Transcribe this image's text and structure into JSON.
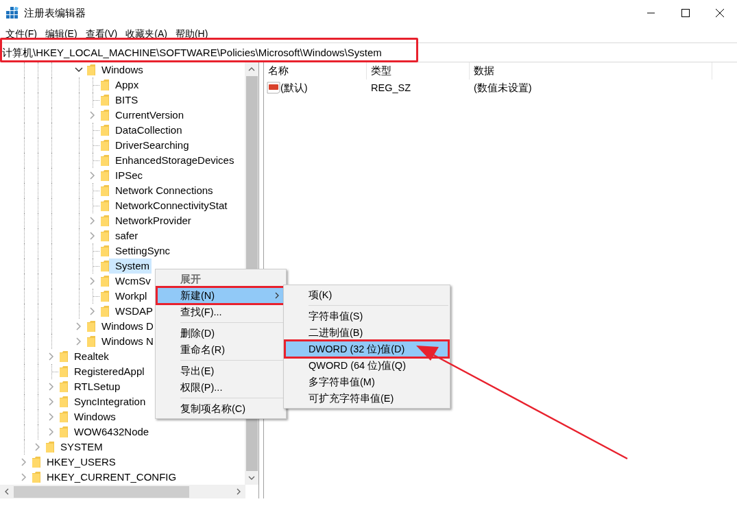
{
  "window": {
    "title": "注册表编辑器"
  },
  "menu_bar": [
    "文件(F)",
    "编辑(E)",
    "查看(V)",
    "收藏夹(A)",
    "帮助(H)"
  ],
  "address_bar": {
    "value": "计算机\\HKEY_LOCAL_MACHINE\\SOFTWARE\\Policies\\Microsoft\\Windows\\System",
    "marked": true
  },
  "tree": {
    "items": [
      {
        "children": [
          {
            "children": [
              {
                "children": [
                  {
                    "children": [
                      {
                        "label": "Windows",
                        "has_children": true,
                        "expanded": true,
                        "selected": false,
                        "children": [
                          {
                            "label": "Appx",
                            "has_children": false,
                            "selected": false
                          },
                          {
                            "label": "BITS",
                            "has_children": false,
                            "selected": false
                          },
                          {
                            "label": "CurrentVersion",
                            "has_children": true,
                            "expanded": false,
                            "selected": false
                          },
                          {
                            "label": "DataCollection",
                            "has_children": false,
                            "selected": false
                          },
                          {
                            "label": "DriverSearching",
                            "has_children": false,
                            "selected": false
                          },
                          {
                            "label": "EnhancedStorageDevices",
                            "has_children": false,
                            "selected": false
                          },
                          {
                            "label": "IPSec",
                            "has_children": true,
                            "expanded": false,
                            "selected": false
                          },
                          {
                            "label": "Network Connections",
                            "has_children": false,
                            "selected": false
                          },
                          {
                            "label": "NetworkConnectivityStat",
                            "has_children": false,
                            "selected": false
                          },
                          {
                            "label": "NetworkProvider",
                            "has_children": true,
                            "expanded": false,
                            "selected": false
                          },
                          {
                            "label": "safer",
                            "has_children": true,
                            "expanded": false,
                            "selected": false
                          },
                          {
                            "label": "SettingSync",
                            "has_children": false,
                            "selected": false
                          },
                          {
                            "label": "System",
                            "has_children": false,
                            "selected": true
                          },
                          {
                            "label": "WcmSv",
                            "has_children": true,
                            "expanded": false,
                            "selected": false
                          },
                          {
                            "label": "Workpl",
                            "has_children": false,
                            "selected": false
                          },
                          {
                            "label": "WSDAP",
                            "has_children": true,
                            "expanded": false,
                            "selected": false
                          }
                        ]
                      },
                      {
                        "label": "Windows D",
                        "has_children": true,
                        "expanded": false,
                        "selected": false
                      },
                      {
                        "label": "Windows N",
                        "has_children": true,
                        "expanded": false,
                        "selected": false
                      }
                    ]
                  }
                ]
              },
              {
                "label": "Realtek",
                "has_children": true,
                "expanded": false,
                "selected": false
              },
              {
                "label": "RegisteredAppl",
                "has_children": false,
                "selected": false
              },
              {
                "label": "RTLSetup",
                "has_children": true,
                "expanded": false,
                "selected": false
              },
              {
                "label": "SyncIntegration",
                "has_children": true,
                "expanded": false,
                "selected": false
              },
              {
                "label": "Windows",
                "has_children": true,
                "expanded": false,
                "selected": false
              },
              {
                "label": "WOW6432Node",
                "has_children": true,
                "expanded": false,
                "selected": false
              }
            ]
          },
          {
            "label": "SYSTEM",
            "has_children": true,
            "expanded": false,
            "selected": false
          }
        ]
      },
      {
        "label": "HKEY_USERS",
        "has_children": true,
        "expanded": false,
        "selected": false
      },
      {
        "label": "HKEY_CURRENT_CONFIG",
        "has_children": true,
        "expanded": false,
        "selected": false
      }
    ]
  },
  "values_list": {
    "columns": [
      "名称",
      "类型",
      "数据"
    ],
    "rows": [
      {
        "name": "(默认)",
        "type": "REG_SZ",
        "data": "(数值未设置)"
      }
    ]
  },
  "context_menu": {
    "items": [
      {
        "kind": "item",
        "label": "展开",
        "default": true,
        "disabled": true,
        "selected": false,
        "submenu": false,
        "marked": false
      },
      {
        "kind": "item",
        "label": "新建(N)",
        "default": false,
        "disabled": false,
        "selected": true,
        "submenu": true,
        "marked": true
      },
      {
        "kind": "item",
        "label": "查找(F)...",
        "default": false,
        "disabled": false,
        "selected": false,
        "submenu": false,
        "marked": false
      },
      {
        "kind": "separator"
      },
      {
        "kind": "item",
        "label": "删除(D)",
        "default": false,
        "disabled": false,
        "selected": false,
        "submenu": false,
        "marked": false
      },
      {
        "kind": "item",
        "label": "重命名(R)",
        "default": false,
        "disabled": false,
        "selected": false,
        "submenu": false,
        "marked": false
      },
      {
        "kind": "separator"
      },
      {
        "kind": "item",
        "label": "导出(E)",
        "default": false,
        "disabled": false,
        "selected": false,
        "submenu": false,
        "marked": false
      },
      {
        "kind": "item",
        "label": "权限(P)...",
        "default": false,
        "disabled": false,
        "selected": false,
        "submenu": false,
        "marked": false
      },
      {
        "kind": "separator"
      },
      {
        "kind": "item",
        "label": "复制项名称(C)",
        "default": false,
        "disabled": false,
        "selected": false,
        "submenu": false,
        "marked": false
      }
    ]
  },
  "submenu": {
    "items": [
      {
        "kind": "item",
        "label": "项(K)",
        "selected": false,
        "marked": false
      },
      {
        "kind": "separator"
      },
      {
        "kind": "item",
        "label": "字符串值(S)",
        "selected": false,
        "marked": false
      },
      {
        "kind": "item",
        "label": "二进制值(B)",
        "selected": false,
        "marked": false
      },
      {
        "kind": "item",
        "label": "DWORD (32 位)值(D)",
        "selected": true,
        "marked": true
      },
      {
        "kind": "item",
        "label": "QWORD (64 位)值(Q)",
        "selected": false,
        "marked": false
      },
      {
        "kind": "item",
        "label": "多字符串值(M)",
        "selected": false,
        "marked": false
      },
      {
        "kind": "item",
        "label": "可扩充字符串值(E)",
        "selected": false,
        "marked": false
      }
    ]
  },
  "annotation_arrow": {
    "kind": "arrow"
  }
}
